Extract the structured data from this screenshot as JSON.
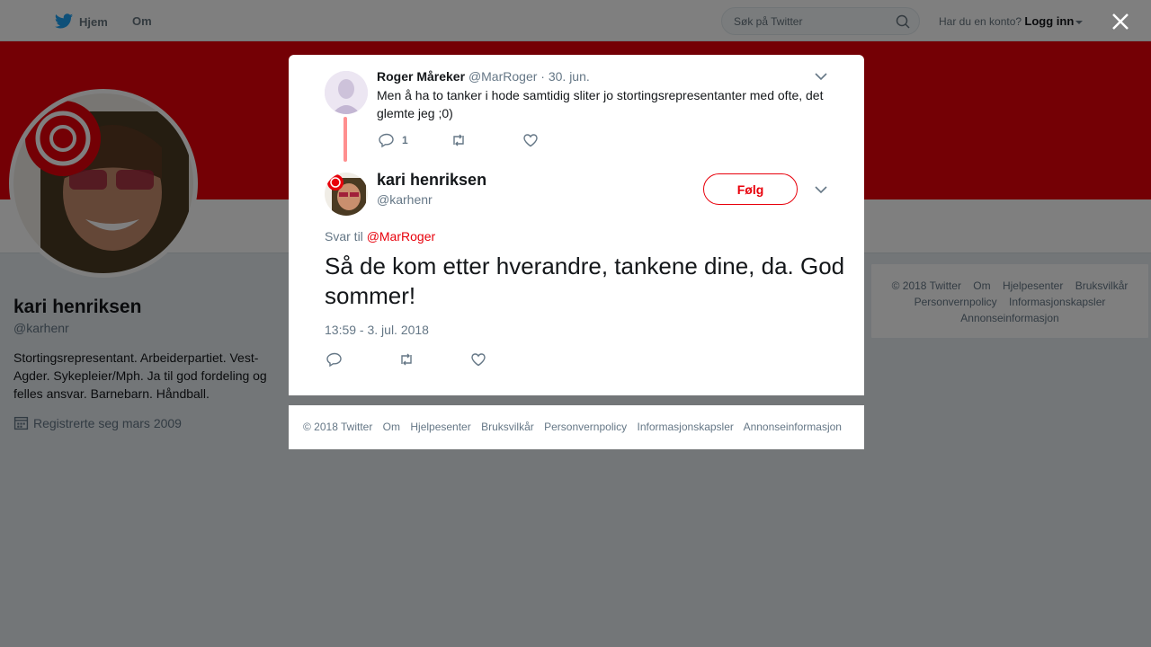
{
  "nav": {
    "home_label": "Hjem",
    "about_label": "Om",
    "search_placeholder": "Søk på Twitter",
    "account_prompt": "Har du en konto?",
    "login_label": "Logg inn"
  },
  "colors": {
    "brand": "#e8000b",
    "twitter_blue": "#1da1f2"
  },
  "profile": {
    "name": "kari henriksen",
    "handle": "@karhenr",
    "bio": "Stortingsrepresentant. Arbeiderpartiet. Vest-Agder. Sykepleier/Mph. Ja til god fordeling og felles ansvar. Barnebarn. Håndball.",
    "joined": "Registrerte seg mars 2009"
  },
  "side_footer": {
    "links": [
      "© 2018 Twitter",
      "Om",
      "Hjelpesenter",
      "Bruksvilkår",
      "Personvernpolicy",
      "Informasjonskapsler",
      "Annonseinformasjon"
    ]
  },
  "parent_tweet": {
    "name": "Roger Måreker",
    "handle": "@MarRoger",
    "separator": "·",
    "date": "30. jun.",
    "text": "Men å ha to tanker i hode samtidig sliter jo stortingsrepresentanter med ofte, det glemte jeg ;0)",
    "reply_count": "1"
  },
  "main_tweet": {
    "name": "kari henriksen",
    "handle": "@karhenr",
    "follow_label": "Følg",
    "reply_prefix": "Svar til",
    "reply_handle": "@MarRoger",
    "text": "Så de kom etter hverandre, tankene dine, da. God sommer!",
    "timestamp": "13:59 - 3. jul. 2018"
  },
  "modal_footer": {
    "links": [
      "© 2018 Twitter",
      "Om",
      "Hjelpesenter",
      "Bruksvilkår",
      "Personvernpolicy",
      "Informasjonskapsler",
      "Annonseinformasjon"
    ]
  }
}
